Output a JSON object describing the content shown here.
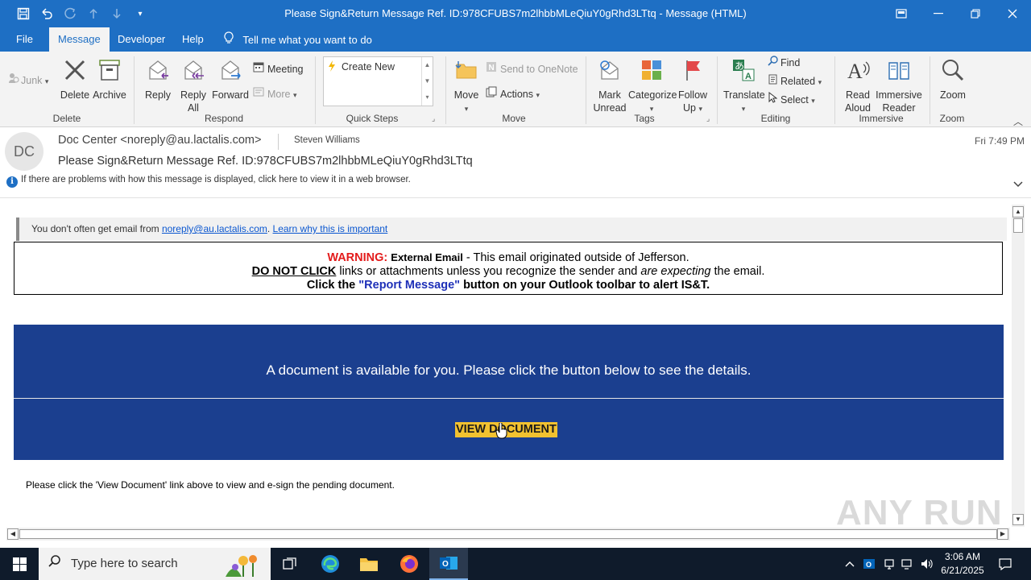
{
  "window": {
    "title": "Please Sign&Return Message Ref. ID:978CFUBS7m2lhbbMLeQiuY0gRhd3LTtq  -  Message (HTML)"
  },
  "ribbon_tabs": [
    {
      "label": "File"
    },
    {
      "label": "Message"
    },
    {
      "label": "Developer"
    },
    {
      "label": "Help"
    }
  ],
  "tell_me": "Tell me what you want to do",
  "ribbon": {
    "junk": "Junk",
    "delete": "Delete",
    "archive": "Archive",
    "reply": "Reply",
    "reply_all_1": "Reply",
    "reply_all_2": "All",
    "forward": "Forward",
    "meeting": "Meeting",
    "more": "More",
    "quick_steps_item": "Create New",
    "move": "Move",
    "send_to_onenote": "Send to OneNote",
    "actions": "Actions",
    "mark_unread_1": "Mark",
    "mark_unread_2": "Unread",
    "categorize": "Categorize",
    "follow_up_1": "Follow",
    "follow_up_2": "Up",
    "translate": "Translate",
    "find": "Find",
    "related": "Related",
    "select": "Select",
    "read_aloud_1": "Read",
    "read_aloud_2": "Aloud",
    "immersive_reader_1": "Immersive",
    "immersive_reader_2": "Reader",
    "zoom": "Zoom",
    "groups": {
      "delete": "Delete",
      "respond": "Respond",
      "quick_steps": "Quick Steps",
      "move": "Move",
      "tags": "Tags",
      "editing": "Editing",
      "immersive": "Immersive",
      "zoom": "Zoom"
    }
  },
  "message": {
    "avatar_initials": "DC",
    "sender": "Doc Center <noreply@au.lactalis.com>",
    "recipient": "Steven Williams",
    "date": "Fri 7:49 PM",
    "subject": "Please Sign&Return Message Ref. ID:978CFUBS7m2lhbbMLeQiuY0gRhd3LTtq",
    "info_bar": "If there are problems with how this message is displayed, click here to view it in a web browser."
  },
  "body": {
    "notice_prefix": "You don't often get email from ",
    "notice_email": "noreply@au.lactalis.com",
    "notice_sep": ". ",
    "notice_link": "Learn why this is important",
    "warning": {
      "label": "WARNING:",
      "external": "External Email",
      "line1_rest": " - This email originated outside of Jefferson.",
      "do_not_click": "DO NOT CLICK",
      "line2_a": " links or attachments unless you recognize the sender and ",
      "line2_em": "are expecting",
      "line2_b": " the email.",
      "line3_a": "Click the ",
      "line3_report": "\"Report Message\"",
      "line3_b": " button on your Outlook toolbar to alert IS&T."
    },
    "banner_text": "A document is available for you. Please click the button below to see the details.",
    "view_document": "VIEW DOCUMENT",
    "bottom_note": "Please click the 'View Document' link above to view and e-sign the pending document."
  },
  "watermark": "ANY RUN",
  "taskbar": {
    "search_placeholder": "Type here to search",
    "time": "3:06 AM",
    "date": "6/21/2025"
  },
  "colors": {
    "accent": "#1e6fc4",
    "banner": "#1b3f8f",
    "button": "#f2c230",
    "warning_red": "#e31b1b"
  }
}
